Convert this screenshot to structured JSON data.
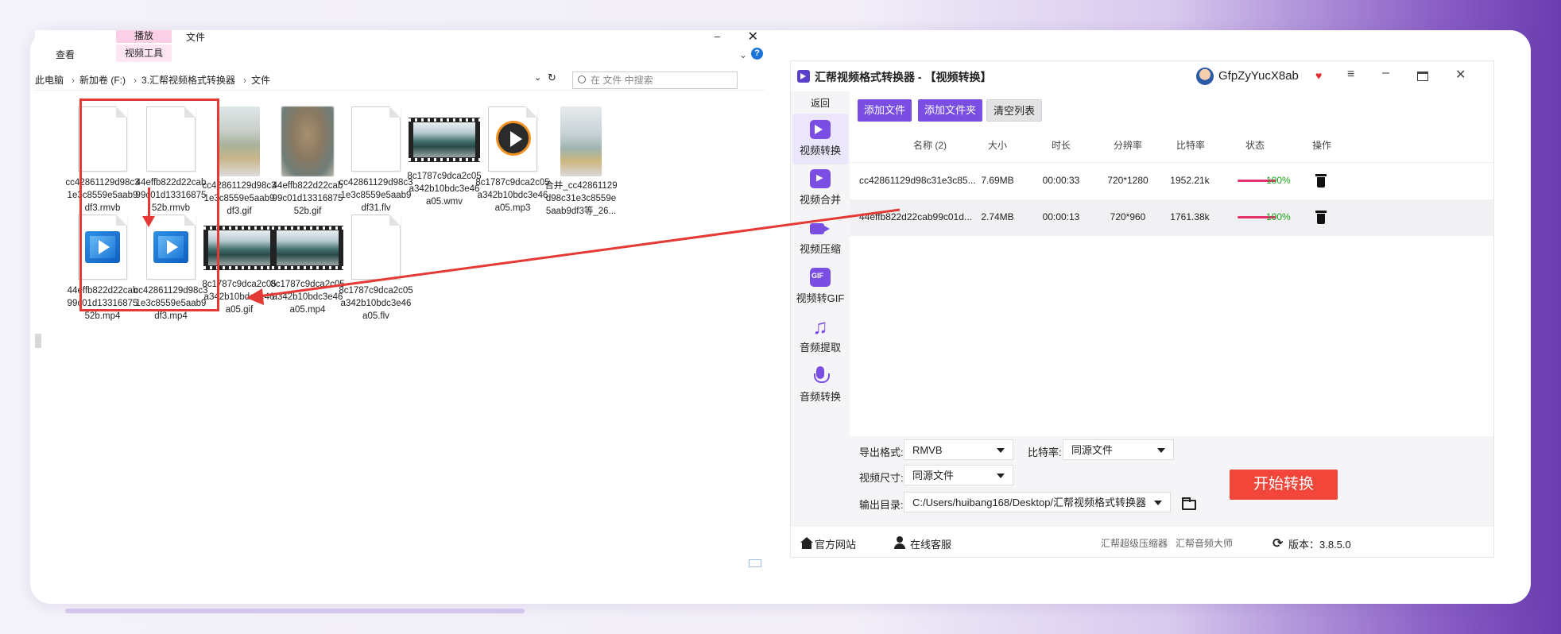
{
  "explorer": {
    "ribbon": {
      "tab_play": "播放",
      "tab_file": "文件",
      "tab_view": "查看",
      "tab_video_tools": "视频工具",
      "window_min": "–",
      "window_close": "✕",
      "chevron": "⌄",
      "help": "?"
    },
    "address": {
      "parts": [
        "此电脑",
        "新加卷 (F:)",
        "3.汇帮视频格式转换器",
        "文件"
      ],
      "separator": "›",
      "dropdown": "⌄",
      "refresh": "↻"
    },
    "search_placeholder": "在 文件 中搜索",
    "files": [
      {
        "name": "cc42861129d98c31e3c8559e5aab9df3.rmvb",
        "icon": "blank-document-icon"
      },
      {
        "name": "44effb822d22cab99c01d1331687552b.rmvb",
        "icon": "blank-document-icon"
      },
      {
        "name": "cc42861129d98c31e3c8559e5aab9df3.gif",
        "icon": "photo-thumbnail-icon"
      },
      {
        "name": "44effb822d22cab99c01d1331687552b.gif",
        "icon": "photo-thumbnail-icon"
      },
      {
        "name": "cc42861129d98c31e3c8559e5aab9df31.flv",
        "icon": "blank-document-icon"
      },
      {
        "name": "8c1787c9dca2c05a342b10bdc3e46a05.wmv",
        "icon": "video-thumbnail-icon"
      },
      {
        "name": "8c1787c9dca2c05a342b10bdc3e46a05.mp3",
        "icon": "audio-disc-icon"
      },
      {
        "name": "合并_cc42861129d98c31e3c8559e5aab9df3等_26...",
        "icon": "photo-thumbnail-icon"
      },
      {
        "name": "44effb822d22cab99c01d1331687552b.mp4",
        "icon": "play-video-icon"
      },
      {
        "name": "cc42861129d98c31e3c8559e5aab9df3.mp4",
        "icon": "play-video-icon"
      },
      {
        "name": "8c1787c9dca2c05a342b10bdc3e46a05.gif",
        "icon": "video-thumbnail-icon"
      },
      {
        "name": "8c1787c9dca2c05a342b10bdc3e46a05.mp4",
        "icon": "video-thumbnail-icon"
      },
      {
        "name": "8c1787c9dca2c05a342b10bdc3e46a05.flv",
        "icon": "blank-document-icon"
      }
    ]
  },
  "app": {
    "title": "汇帮视频格式转换器 - 【视频转换】",
    "user": "GfpZyYucX8ab",
    "vip_icon": "♥",
    "menu_icon": "≡",
    "min_icon": "–",
    "close_icon": "✕",
    "sidebar": {
      "back": "返回",
      "items": [
        {
          "label": "视频转换",
          "icon": "video-convert-icon",
          "active": true
        },
        {
          "label": "视频合并",
          "icon": "video-merge-icon",
          "active": false
        },
        {
          "label": "视频压缩",
          "icon": "video-compress-icon",
          "active": false
        },
        {
          "label": "视频转GIF",
          "icon": "gif-icon",
          "active": false
        },
        {
          "label": "音频提取",
          "icon": "music-note-icon",
          "active": false
        },
        {
          "label": "音频转换",
          "icon": "microphone-icon",
          "active": false
        }
      ]
    },
    "toolbar": {
      "add_file": "添加文件",
      "add_folder": "添加文件夹",
      "clear_list": "清空列表"
    },
    "table": {
      "headers": {
        "name": "名称 (2)",
        "size": "大小",
        "duration": "时长",
        "resolution": "分辨率",
        "bitrate": "比特率",
        "status": "状态",
        "action": "操作"
      },
      "rows": [
        {
          "name": "cc42861129d98c31e3c85...",
          "size": "7.69MB",
          "duration": "00:00:33",
          "resolution": "720*1280",
          "bitrate": "1952.21k",
          "progress": 1.0,
          "status": "100%"
        },
        {
          "name": "44effb822d22cab99c01d...",
          "size": "2.74MB",
          "duration": "00:00:13",
          "resolution": "720*960",
          "bitrate": "1761.38k",
          "progress": 1.0,
          "status": "100%"
        }
      ]
    },
    "settings": {
      "format_label": "导出格式:",
      "format_value": "RMVB",
      "bitrate_label": "比特率:",
      "bitrate_value": "同源文件",
      "size_label": "视频尺寸:",
      "size_value": "同源文件",
      "output_label": "输出目录:",
      "output_value": "C:/Users/huibang168/Desktop/汇帮视频格式转换器"
    },
    "start_button": "开始转换",
    "footer": {
      "website": "官方网站",
      "support": "在线客服",
      "product1": "汇帮超级压缩器",
      "product2": "汇帮音频大师",
      "version": "版本：3.8.5.0",
      "refresh_icon": "⟳"
    }
  },
  "colors": {
    "accent": "#7b4ee3",
    "start_button": "#f2463b",
    "annotation_red": "#e53935",
    "progress": "#e2346a",
    "status_green": "#1aa31a"
  }
}
